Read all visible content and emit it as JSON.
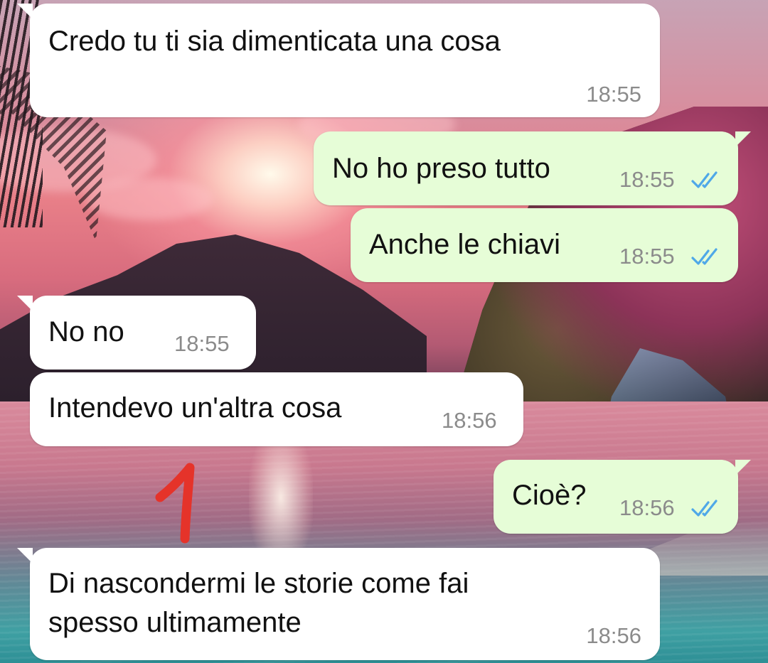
{
  "chat": {
    "messages": [
      {
        "id": "m1",
        "direction": "incoming",
        "text": "Credo tu ti sia dimenticata una cosa",
        "time": "18:55"
      },
      {
        "id": "m2",
        "direction": "outgoing",
        "text": "No ho preso tutto",
        "time": "18:55",
        "status": "read"
      },
      {
        "id": "m3",
        "direction": "outgoing",
        "text": "Anche le chiavi",
        "time": "18:55",
        "status": "read"
      },
      {
        "id": "m4",
        "direction": "incoming",
        "text": "No no",
        "time": "18:55"
      },
      {
        "id": "m5",
        "direction": "incoming",
        "text": "Intendevo un'altra cosa",
        "time": "18:56"
      },
      {
        "id": "m6",
        "direction": "outgoing",
        "text": "Cioè?",
        "time": "18:56",
        "status": "read"
      },
      {
        "id": "m7",
        "direction": "incoming",
        "text_line1": "Di nascondermi le storie come fai",
        "text_line2": "spesso ultimamente",
        "time": "18:56"
      }
    ]
  },
  "annotation": {
    "label": "1",
    "color": "#e5332a"
  },
  "colors": {
    "incoming_bubble": "#ffffff",
    "outgoing_bubble": "#e6fdd7",
    "read_ticks": "#4fa8e8",
    "timestamp": "#8b8b8b"
  },
  "icons": {
    "read_receipt": "double-check-icon"
  }
}
